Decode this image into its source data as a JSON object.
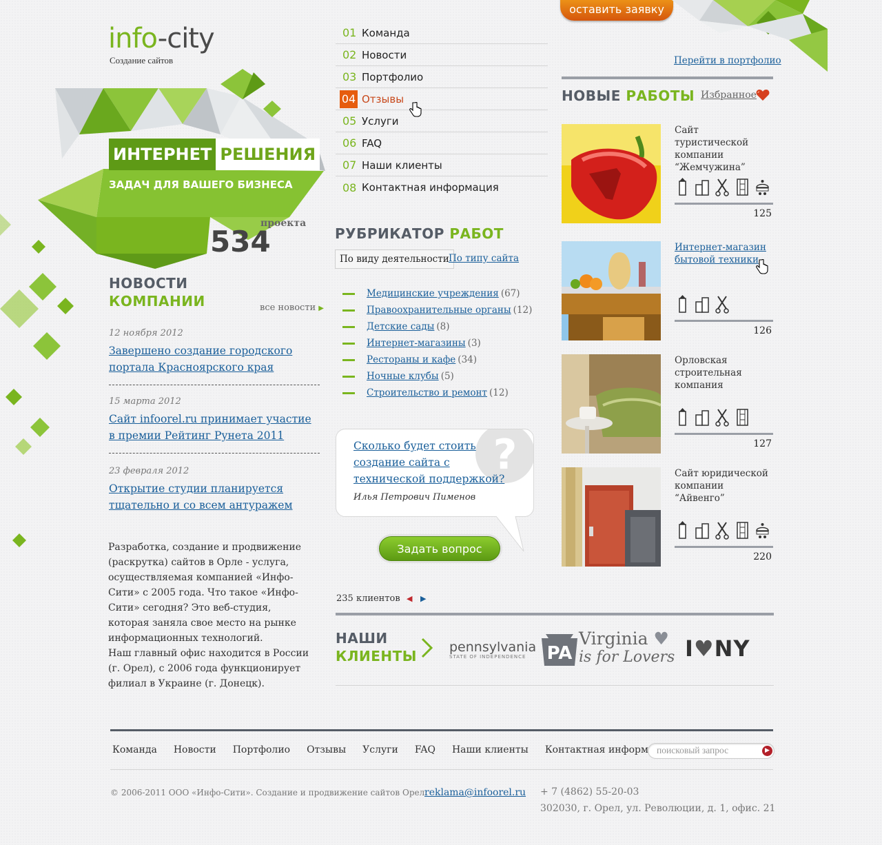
{
  "header": {
    "logo_part1": "info",
    "logo_part2": "-city",
    "tagline": "Создание сайтов",
    "cta_label": "оставить заявку"
  },
  "hero": {
    "word1": "ИНТЕРНЕТ",
    "word2": "РЕШЕНИЯ",
    "subtitle": "ЗАДАЧ ДЛЯ ВАШЕГО БИЗНЕСА",
    "projects_count": "534",
    "projects_label": "проекта"
  },
  "menu": {
    "items": [
      {
        "num": "01",
        "label": "Команда"
      },
      {
        "num": "02",
        "label": "Новости"
      },
      {
        "num": "03",
        "label": "Портфолио"
      },
      {
        "num": "04",
        "label": "Отзывы"
      },
      {
        "num": "05",
        "label": "Услуги"
      },
      {
        "num": "06",
        "label": "FAQ"
      },
      {
        "num": "07",
        "label": "Наши клиенты"
      },
      {
        "num": "08",
        "label": "Контактная информация"
      }
    ],
    "active_index": 3
  },
  "news": {
    "title_line1": "НОВОСТИ",
    "title_line2": "КОМПАНИИ",
    "all_link": "все новости",
    "items": [
      {
        "date": "12 ноября 2012",
        "title": "Завершено создание городского портала Красноярского края"
      },
      {
        "date": "15 марта 2012",
        "title": "Сайт infoorel.ru принимает участие в премии Рейтинг Рунета 2011"
      },
      {
        "date": "23 февраля 2012",
        "title": "Открытие студии планируется тщательно и со всем антуражем"
      }
    ]
  },
  "about": {
    "paragraph1": "Разработка, создание и продвижение (раскрутка) сайтов в Орле - услуга, осуществляемая компанией «Инфо-Сити» с 2005 года. Что такое «Инфо-Сити» сегодня? Это веб-студия, которая заняла свое место на рынке информационных технологий.",
    "paragraph2": "Наш главный офис находится в России (г. Орел), с 2006 года функционирует филиал в Украине (г. Донецк)."
  },
  "rubricator": {
    "title_part1": "РУБРИКАТОР",
    "title_part2": "РАБОТ",
    "tab_active": "По виду деятельности",
    "tab_other": "По типу сайта",
    "items": [
      {
        "label": "Медицинские учреждения",
        "count": "(67)"
      },
      {
        "label": "Правоохранительные органы",
        "count": "(12)"
      },
      {
        "label": "Детские сады",
        "count": "(8)"
      },
      {
        "label": "Интернет-магазины",
        "count": "(3)"
      },
      {
        "label": "Рестораны и кафе",
        "count": "(34)"
      },
      {
        "label": "Ночные клубы",
        "count": "(5)"
      },
      {
        "label": "Строительство и ремонт",
        "count": "(12)"
      }
    ]
  },
  "question": {
    "text": "Сколько будет стоить создание сайта с технической поддержкой?",
    "author": "Илья Петрович Пименов",
    "mark": "?",
    "button": "Задать вопрос"
  },
  "clients": {
    "count_label": "235 клиентов",
    "title_line1": "НАШИ",
    "title_line2": "КЛИЕНТЫ",
    "pa_word": "pennsylvania",
    "pa_sub": "STATE OF INDEPENDENCE",
    "pa_badge": "PA",
    "va_line1": "Virginia",
    "va_line2": "is for Lovers",
    "ny_i": "I",
    "ny_ny": "NY"
  },
  "works": {
    "portfolio_link": "Перейти в портфолио",
    "title_part1": "НОВЫЕ",
    "title_part2": "РАБОТЫ",
    "favorites": "Избранное",
    "items": [
      {
        "title": "Сайт туристической компании “Жемчужина”",
        "num": "125",
        "is_link": false
      },
      {
        "title": "Интернет-магазин бытовой техники",
        "num": "126",
        "is_link": true
      },
      {
        "title": "Орловская строительная компания",
        "num": "127",
        "is_link": false
      },
      {
        "title": "Сайт юридической компании “Айвенго”",
        "num": "220",
        "is_link": false
      }
    ]
  },
  "footer": {
    "nav": [
      "Команда",
      "Новости",
      "Портфолио",
      "Отзывы",
      "Услуги",
      "FAQ",
      "Наши клиенты",
      "Контактная информация"
    ],
    "search_placeholder": "поисковый запрос",
    "copyright": "© 2006-2011 ООО «Инфо-Сити».  Создание и продвижение сайтов Орел.",
    "email": "reklama@infoorel.ru",
    "phone": "+ 7 (4862) 55-20-03",
    "address": "302030, г. Орел, ул. Революции, д. 1, офис. 21"
  },
  "colors": {
    "accent_green": "#7ab51f",
    "accent_orange": "#e65c0e",
    "link_blue": "#1a5f9a"
  }
}
